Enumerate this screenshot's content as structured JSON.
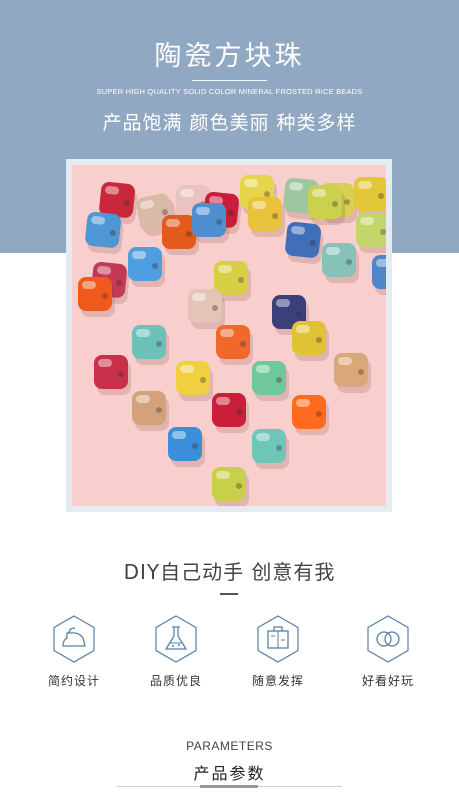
{
  "colors": {
    "hero_background": "#91a8c3",
    "photo_background": "#f8cfcc",
    "icon_stroke": "#5a7fa6"
  },
  "header": {
    "title": "陶瓷方块珠",
    "subtitle_en": "SUPER HIGH QUALITY SOLID COLOR MINERAL FROSTED RICE BEADS",
    "slogan": "产品饱满 颜色美丽 种类多样"
  },
  "photo": {
    "subject": "ceramic cube beads"
  },
  "diy": {
    "heading": "DIY自己动手 创意有我"
  },
  "features": [
    {
      "label": "简约设计",
      "icon": "iron-icon"
    },
    {
      "label": "品质优良",
      "icon": "flask-icon"
    },
    {
      "label": "随意发挥",
      "icon": "toolkit-icon"
    },
    {
      "label": "好看好玩",
      "icon": "rings-icon"
    }
  ],
  "parameters": {
    "heading_en": "PARAMETERS",
    "heading_cn": "产品参数"
  }
}
